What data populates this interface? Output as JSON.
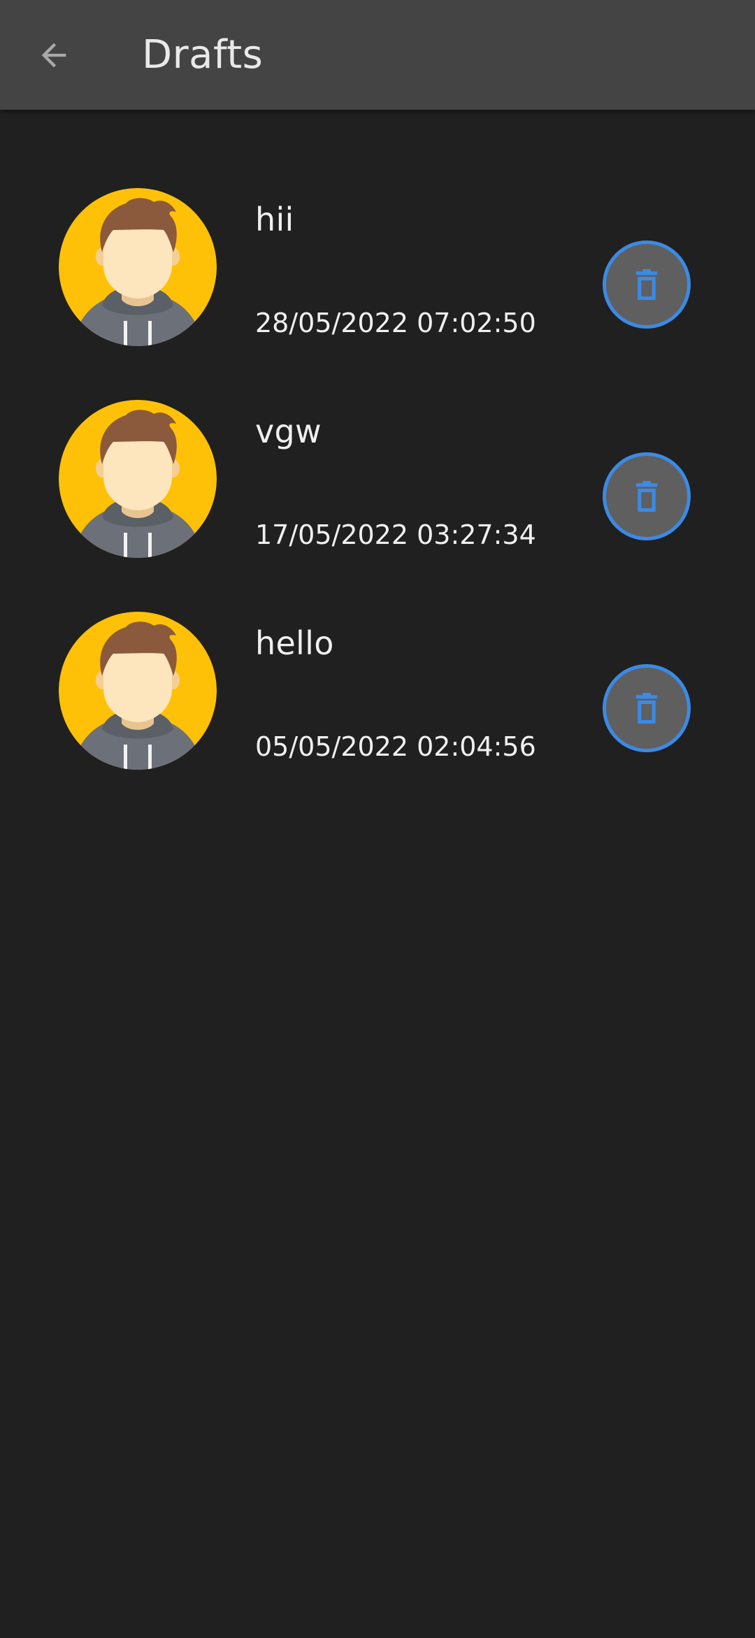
{
  "app_bar": {
    "title": "Drafts",
    "back_icon": "arrow-left-icon"
  },
  "colors": {
    "app_bar_bg": "#444444",
    "page_bg": "#202020",
    "accent_blue": "#3b8ae6",
    "avatar_yellow": "#ffc107"
  },
  "drafts": [
    {
      "name": "hii",
      "timestamp": "28/05/2022 07:02:50",
      "avatar_icon": "user-avatar-icon",
      "delete_icon": "trash-icon"
    },
    {
      "name": "vgw",
      "timestamp": "17/05/2022 03:27:34",
      "avatar_icon": "user-avatar-icon",
      "delete_icon": "trash-icon"
    },
    {
      "name": "hello",
      "timestamp": "05/05/2022 02:04:56",
      "avatar_icon": "user-avatar-icon",
      "delete_icon": "trash-icon"
    }
  ]
}
